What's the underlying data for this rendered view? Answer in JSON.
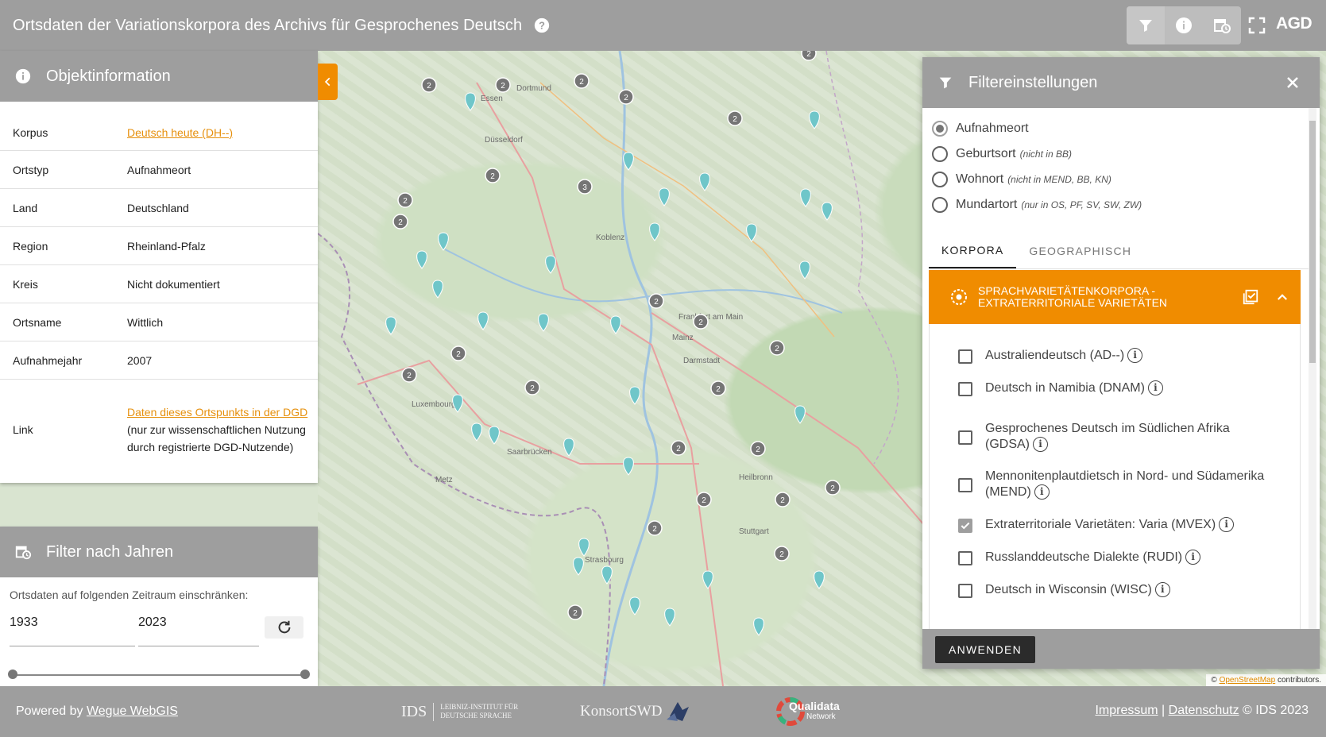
{
  "header": {
    "title": "Ortsdaten der Variationskorpora des Archivs für Gesprochenes Deutsch",
    "logo_text": "AGD"
  },
  "objekt": {
    "title": "Objektinformation",
    "rows": [
      {
        "key": "Korpus",
        "value": "Deutsch heute (DH--)",
        "link": true
      },
      {
        "key": "Ortstyp",
        "value": "Aufnahmeort"
      },
      {
        "key": "Land",
        "value": "Deutschland"
      },
      {
        "key": "Region",
        "value": "Rheinland-Pfalz"
      },
      {
        "key": "Kreis",
        "value": "Nicht dokumentiert"
      },
      {
        "key": "Ortsname",
        "value": "Wittlich"
      },
      {
        "key": "Aufnahmejahr",
        "value": "2007"
      }
    ],
    "link_row": {
      "key": "Link",
      "link_text": "Daten dieses Ortspunkts in der DGD",
      "note": "(nur zur wissenschaftlichen Nutzung durch registrierte DGD-Nutzende)"
    }
  },
  "year_filter": {
    "title": "Filter nach Jahren",
    "hint": "Ortsdaten auf folgenden Zeitraum einschränken:",
    "from": "1933",
    "to": "2023"
  },
  "filter": {
    "title": "Filtereinstellungen",
    "radios": [
      {
        "label": "Aufnahmeort",
        "note": "",
        "checked": true
      },
      {
        "label": "Geburtsort",
        "note": "(nicht in BB)",
        "checked": false
      },
      {
        "label": "Wohnort",
        "note": "(nicht in MEND, BB, KN)",
        "checked": false
      },
      {
        "label": "Mundartort",
        "note": "(nur in OS, PF, SV, SW, ZW)",
        "checked": false
      }
    ],
    "tabs": [
      "KORPORA",
      "GEOGRAPHISCH"
    ],
    "group_title_line1": "SPRACHVARIETÄTENKORPORA -",
    "group_title_line2": "EXTRATERRITORIALE VARIETÄTEN",
    "corpora": [
      {
        "label": "Australiendeutsch (AD--)",
        "checked": false
      },
      {
        "label": "Deutsch in Namibia (DNAM)",
        "checked": false
      },
      {
        "label": "Gesprochenes Deutsch im Südlichen Afrika (GDSA)",
        "checked": false
      },
      {
        "label": "Mennonitenplautdietsch in Nord- und Südamerika (MEND)",
        "checked": false
      },
      {
        "label": "Extraterritoriale Varietäten: Varia (MVEX)",
        "checked": true
      },
      {
        "label": "Russlanddeutsche Dialekte (RUDI)",
        "checked": false
      },
      {
        "label": "Deutsch in Wisconsin (WISC)",
        "checked": false
      }
    ],
    "apply_label": "ANWENDEN"
  },
  "map": {
    "cities": [
      "Dortmund",
      "Essen",
      "Düsseldorf",
      "Frankfurt am Main",
      "Mainz",
      "Luxembourg",
      "Strasbourg",
      "Stuttgart",
      "Heilbronn",
      "Metz",
      "Saarbrücken",
      "Koblenz",
      "Darmstadt"
    ],
    "attribution_prefix": "©",
    "attribution_link": "OpenStreetMap",
    "attribution_suffix": "contributors.",
    "cluster_label": "2",
    "cluster_label_3": "3"
  },
  "footer": {
    "powered_prefix": "Powered by",
    "powered_link": "Wegue WebGIS",
    "ids_logo": "IDS",
    "ids_sub": "LEIBNIZ-INSTITUT FÜR DEUTSCHE SPRACHE",
    "konsort": "KonsortSWD",
    "qualidata": "Qualidata",
    "qualidata_sub": "Network",
    "impressum": "Impressum",
    "sep": "|",
    "datenschutz": "Datenschutz",
    "copyright": "© IDS 2023"
  }
}
